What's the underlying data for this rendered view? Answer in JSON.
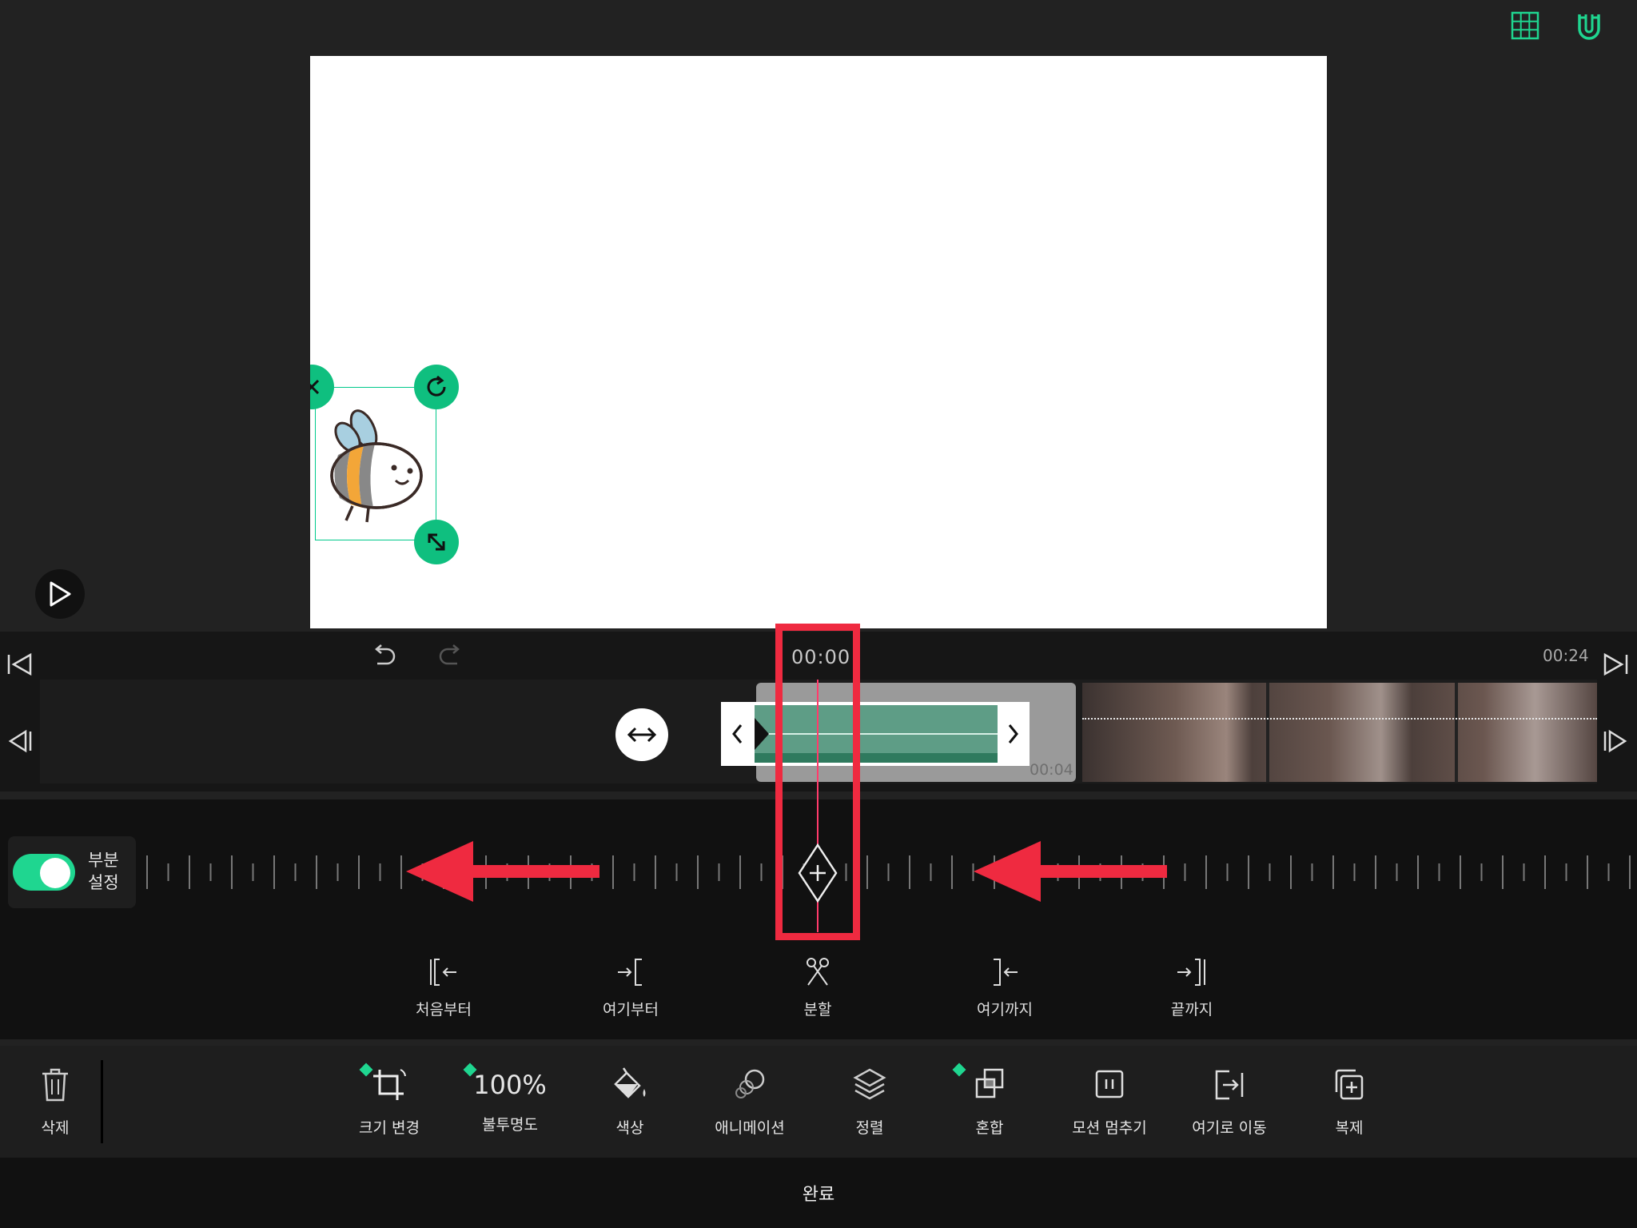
{
  "preview": {
    "top_icons": [
      "grid-icon",
      "magnet-icon"
    ],
    "play_icon": "play-icon"
  },
  "timeline": {
    "current_time": "00:00",
    "total_time": "00:24",
    "clip_duration": "00:04"
  },
  "keyframe": {
    "partial_setting_label": "부분\n설정",
    "partial_setting_on": true
  },
  "actions": [
    {
      "id": "from-start",
      "label": "처음부터"
    },
    {
      "id": "from-here",
      "label": "여기부터"
    },
    {
      "id": "split",
      "label": "분할"
    },
    {
      "id": "until-here",
      "label": "여기까지"
    },
    {
      "id": "until-end",
      "label": "끝까지"
    }
  ],
  "toolbar": {
    "delete_label": "삭제",
    "resize_label": "크기 변경",
    "opacity_value": "100%",
    "opacity_label": "불투명도",
    "color_label": "색상",
    "animation_label": "애니메이션",
    "arrange_label": "정렬",
    "blend_label": "혼합",
    "motion_stop_label": "모션 멈추기",
    "move_here_label": "여기로 이동",
    "duplicate_label": "복제"
  },
  "done_label": "완료",
  "colors": {
    "accent_green": "#1fd690",
    "highlight_red": "#ef2a40",
    "playhead": "#ff3b6b"
  }
}
